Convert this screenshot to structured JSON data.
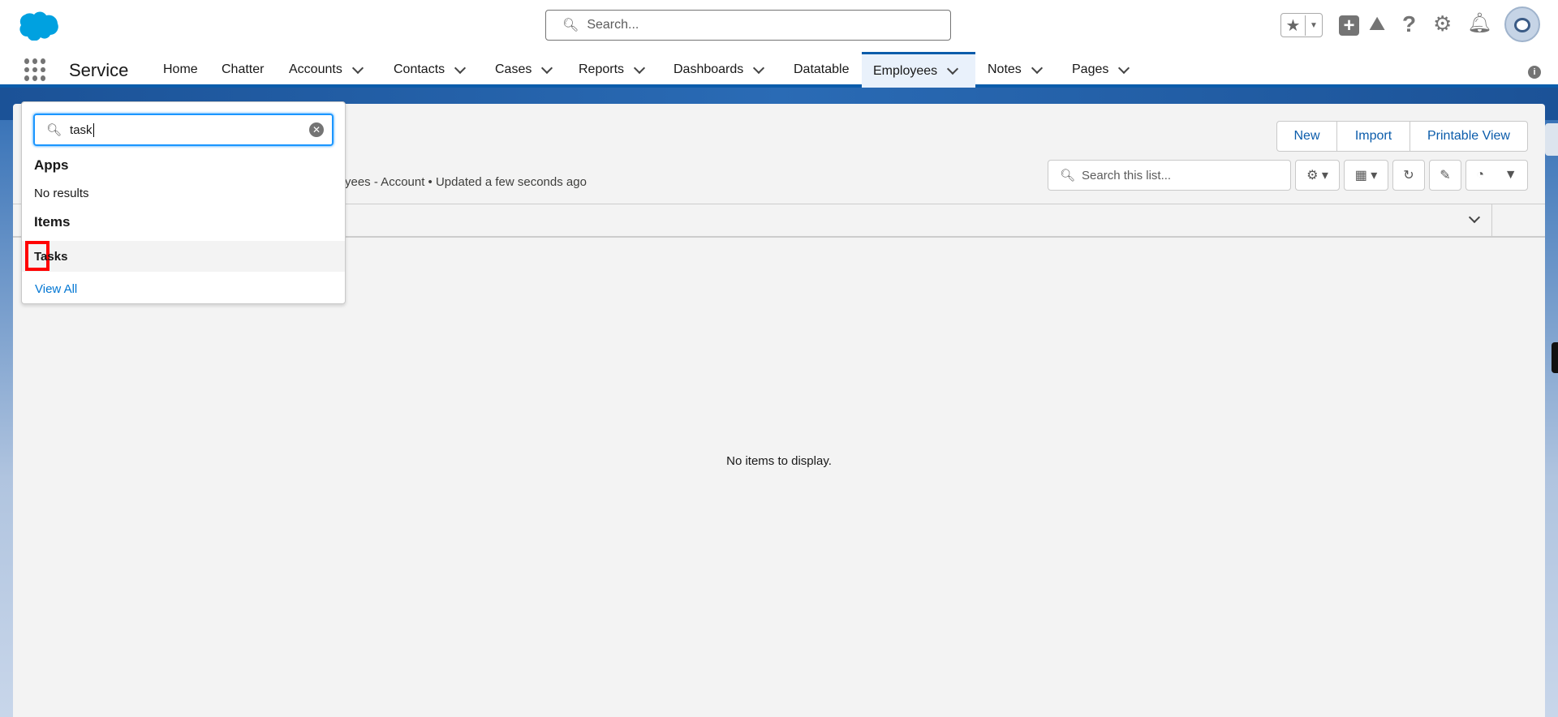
{
  "header": {
    "search_placeholder": "Search...",
    "icons": [
      "favorites-star-icon",
      "add-icon",
      "trailhead-icon",
      "help-icon",
      "setup-gear-icon",
      "notification-bell-icon",
      "user-avatar"
    ]
  },
  "nav": {
    "app_name": "Service",
    "items": [
      {
        "label": "Home",
        "chevron": false
      },
      {
        "label": "Chatter",
        "chevron": false
      },
      {
        "label": "Accounts",
        "chevron": true
      },
      {
        "label": "Contacts",
        "chevron": true
      },
      {
        "label": "Cases",
        "chevron": true
      },
      {
        "label": "Reports",
        "chevron": true
      },
      {
        "label": "Dashboards",
        "chevron": true
      },
      {
        "label": "Datatable",
        "chevron": false
      },
      {
        "label": "Employees",
        "chevron": true,
        "active": true
      },
      {
        "label": "Notes",
        "chevron": true
      },
      {
        "label": "Pages",
        "chevron": true
      }
    ]
  },
  "list": {
    "subtitle": "yees - Account • Updated a few seconds ago",
    "search_placeholder": "Search this list...",
    "buttons": {
      "new": "New",
      "import": "Import",
      "printable": "Printable View"
    },
    "empty": "No items to display."
  },
  "launcher": {
    "query": "task",
    "apps_heading": "Apps",
    "apps_empty": "No results",
    "items_heading": "Items",
    "result": "Tasks",
    "view_all": "View All"
  },
  "colors": {
    "brand": "#0b5cab",
    "link": "#0176d3",
    "highlight": "#ff0000"
  }
}
